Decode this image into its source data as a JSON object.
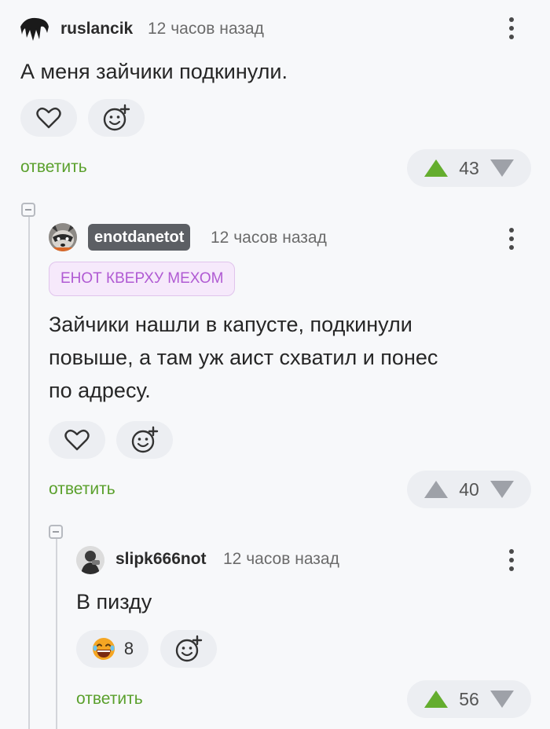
{
  "comments": [
    {
      "username": "ruslancik",
      "time": "12 часов назад",
      "text": "А меня зайчики подкинули.",
      "reply_label": "ответить",
      "rating": "43"
    },
    {
      "username": "enotdanetot",
      "time": "12 часов назад",
      "tag": "ЕНОТ КВЕРХУ МЕХОМ",
      "text_lines": [
        "Зайчики нашли в капусте, подкинули",
        "повыше, а там уж аист схватил и понес",
        "по адресу."
      ],
      "reply_label": "ответить",
      "rating": "40"
    },
    {
      "username": "slipk666not",
      "time": "12 часов назад",
      "text": "В пизду",
      "reaction_count": "8",
      "reply_label": "ответить",
      "rating": "56"
    }
  ],
  "colors": {
    "reply_green": "#5aa02c",
    "upvote_active": "#64ad2e",
    "vote_inactive": "#9ea1a8",
    "tag_purple": "#b05ad3"
  },
  "icons": [
    "avatar-hair-icon",
    "raccoon-avatar",
    "person-avatar",
    "heart-icon",
    "add-reaction-icon",
    "laughing-emoji-icon",
    "more-vertical-icon",
    "collapse-icon",
    "upvote-icon",
    "downvote-icon"
  ]
}
